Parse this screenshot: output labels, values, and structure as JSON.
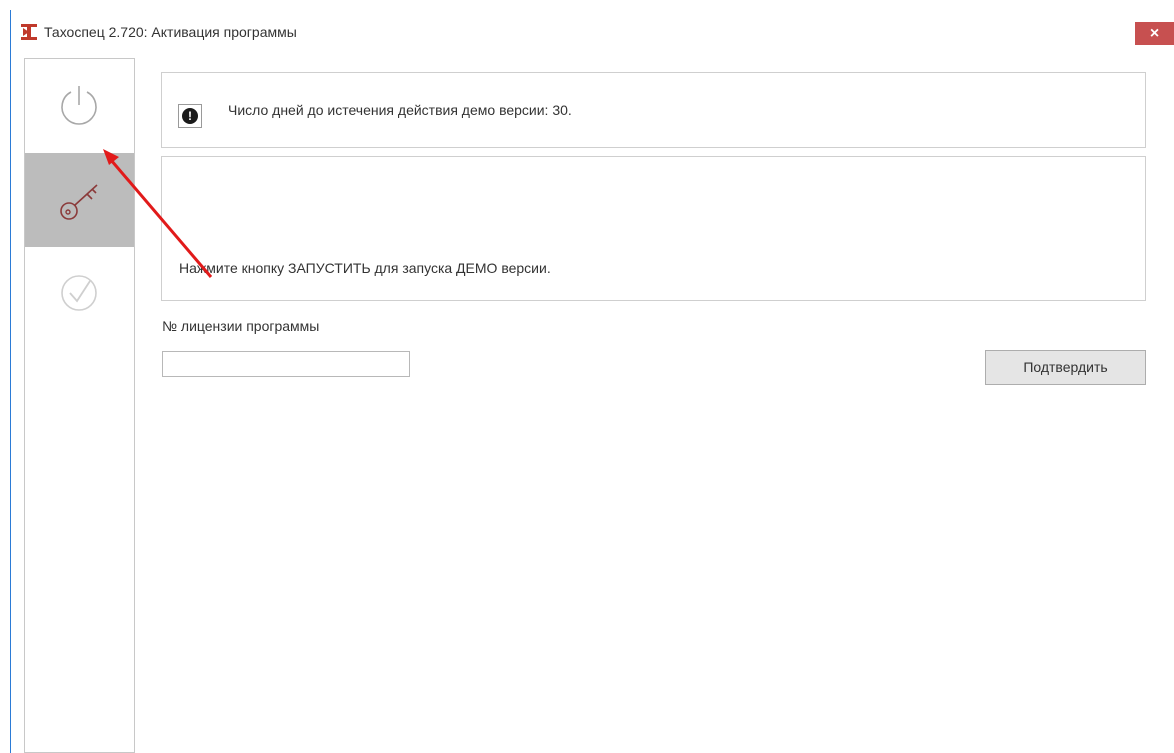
{
  "window": {
    "title": "Тахоспец 2.720: Активация программы",
    "close_label": "×",
    "app_icon": "app-logo-icon"
  },
  "sidebar": {
    "items": [
      {
        "id": "power",
        "icon": "power-icon",
        "active": false
      },
      {
        "id": "key",
        "icon": "key-icon",
        "active": true
      },
      {
        "id": "check",
        "icon": "check-circle-icon",
        "active": false
      }
    ]
  },
  "notice": {
    "icon": "exclamation-icon",
    "icon_glyph": "!",
    "text": "Число дней до истечения действия демо версии: 30."
  },
  "info": {
    "text": "Нажмите кнопку ЗАПУСТИТЬ для запуска ДЕМО версии."
  },
  "license": {
    "label": "№ лицензии программы",
    "value": "",
    "placeholder": ""
  },
  "actions": {
    "confirm_label": "Подтвердить"
  },
  "colors": {
    "accent_close": "#c75050",
    "active_nav": "#bcbcbc",
    "key_icon": "#8b3a3a",
    "annotation_arrow": "#e11a1a",
    "window_border": "#2b7bd6"
  }
}
